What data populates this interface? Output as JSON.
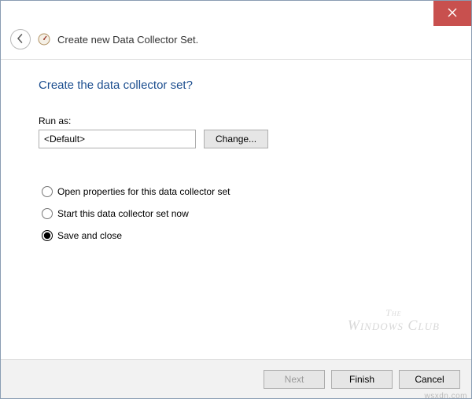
{
  "titlebar": {
    "close_icon": "close"
  },
  "header": {
    "title": "Create new Data Collector Set."
  },
  "content": {
    "heading": "Create the data collector set?",
    "run_as_label": "Run as:",
    "run_as_value": "<Default>",
    "change_button": "Change..."
  },
  "options": [
    {
      "label": "Open properties for this data collector set",
      "checked": false
    },
    {
      "label": "Start this data collector set now",
      "checked": false
    },
    {
      "label": "Save and close",
      "checked": true
    }
  ],
  "watermark": {
    "line1": "The",
    "line2": "Windows Club"
  },
  "footer": {
    "next": "Next",
    "finish": "Finish",
    "cancel": "Cancel"
  },
  "attribution": "wsxdn.com"
}
